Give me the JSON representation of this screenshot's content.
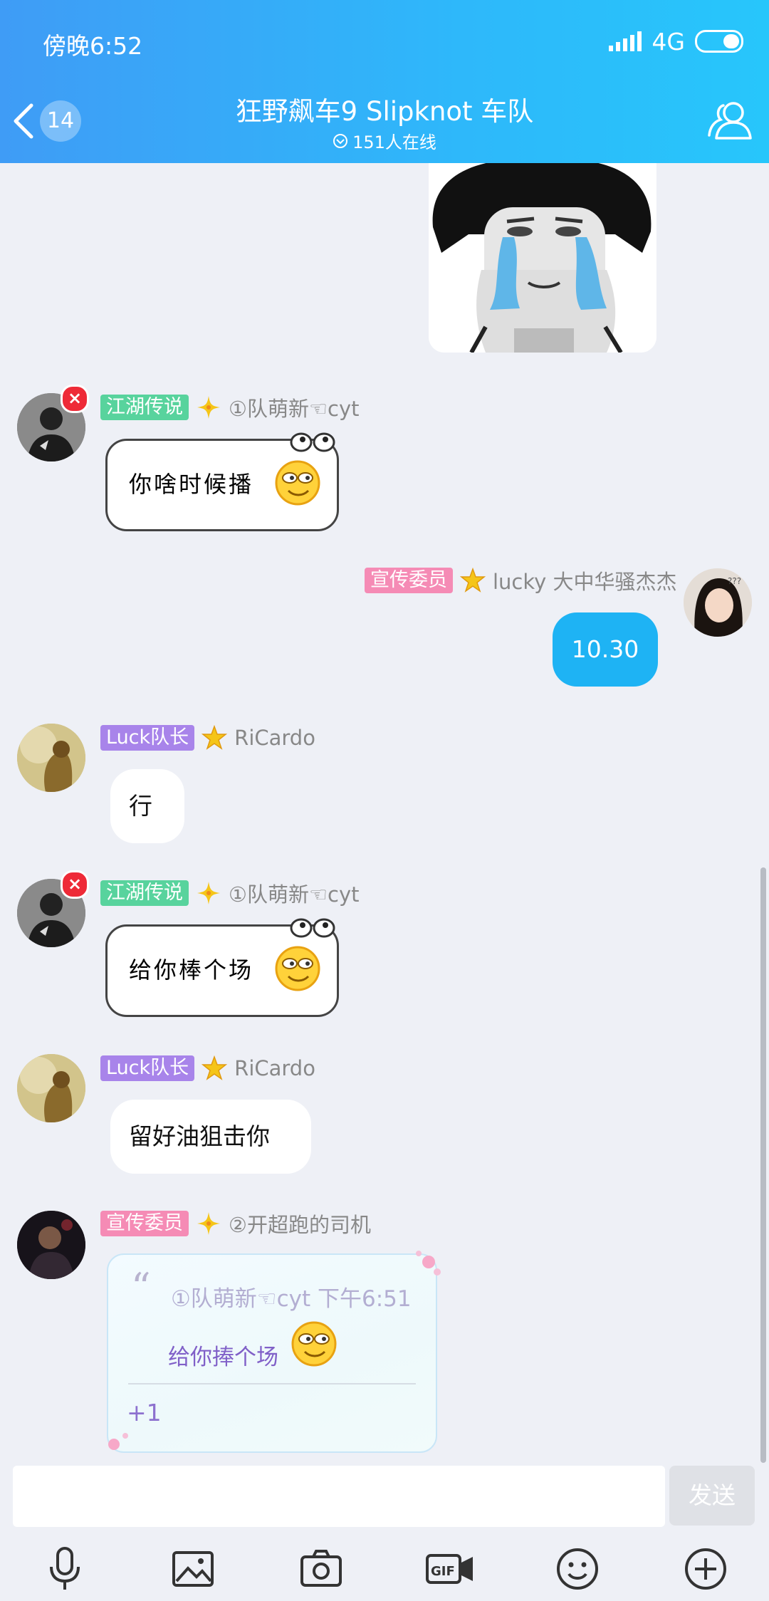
{
  "status": {
    "time": "傍晚6:52",
    "network": "4G"
  },
  "header": {
    "unread_count": "14",
    "title": "狂野飙车9 Slipknot 车队",
    "online": "151人在线"
  },
  "messages": [
    {
      "tag": "江湖传说",
      "nick": "①队萌新☜cyt",
      "text": "你啥时候播"
    },
    {
      "tag": "宣传委员",
      "nick": "lucky 大中华骚杰杰",
      "text": "10.30"
    },
    {
      "tag": "Luck队长",
      "nick": "RiCardo",
      "text": "行"
    },
    {
      "tag": "江湖传说",
      "nick": "①队萌新☜cyt",
      "text": "给你棒个场"
    },
    {
      "tag": "Luck队长",
      "nick": "RiCardo",
      "text": "留好油狙击你"
    },
    {
      "tag": "宣传委员",
      "nick": "②开超跑的司机",
      "quote": {
        "mark": "“",
        "info": "①队萌新☜cyt 下午6:51",
        "text": "给你捧个场"
      },
      "text": "+1"
    }
  ],
  "composer": {
    "value": "",
    "send_label": "发送"
  },
  "toolbar": [
    "microphone-icon",
    "image-icon",
    "camera-icon",
    "gif-icon",
    "emoji-icon",
    "plus-icon"
  ],
  "colors": {
    "header_start": "#3f9cf6",
    "header_end": "#27c6fb",
    "own_bubble": "#1eb3f4",
    "tag_green": "#58d39d",
    "tag_pink": "#f58bb5",
    "tag_purple": "#a884ea"
  }
}
